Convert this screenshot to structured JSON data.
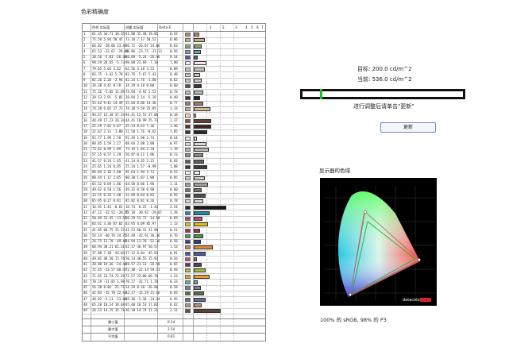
{
  "page_title": "色彩精确度",
  "table_header": {
    "idx": "",
    "ref": "色样 实际值",
    "meas": "测量 实际值",
    "delta": "Delta E",
    "scale": [
      "1",
      "2",
      "3",
      "4",
      "5",
      "6",
      "7"
    ]
  },
  "rows": [
    {
      "id": "1",
      "ref": "61.35  34.71  18.35",
      "meas": "61.80  35.48  19.81",
      "de": "0.43",
      "sw": "#c2817a",
      "v": 0.43,
      "bar": "#c2817a"
    },
    {
      "id": "2",
      "ref": "75.50  5.84  50.45",
      "meas": "73.18  7.17  50.52",
      "de": "0.86",
      "sw": "#c8b07a",
      "v": 0.86,
      "bar": "#c8b07a"
    },
    {
      "id": "3",
      "ref": "66.82  -28.06  23.47",
      "meas": "66.72  -26.07  24.06",
      "de": "0.63",
      "sw": "#8bab72",
      "v": 0.63,
      "bar": "#8bab72"
    },
    {
      "id": "4",
      "ref": "65.53  -22.67  -29.46",
      "meas": "66.86  -23.75  -31.13",
      "de": "0.56",
      "sw": "#5fa6c0",
      "v": 0.56,
      "bar": "#5fa6c0"
    },
    {
      "id": "5",
      "ref": "38.56  -5.03  -26.48",
      "meas": "40.09  -5.24  -26.96",
      "de": "0.34",
      "sw": "#505f8a",
      "v": 0.34,
      "bar": "#505f8a"
    },
    {
      "id": "6",
      "ref": "98.19  20.65  -5.73",
      "meas": "98.88  22.69  -7.16",
      "de": "1.00",
      "sw": "#f5e6ef",
      "v": 1.0,
      "bar": "#f5e6ef"
    },
    {
      "id": "7",
      "ref": "79.65  5.03  3.62",
      "meas": "82.56  4.18  3.52",
      "de": "0.89",
      "sw": "#d0c2bd",
      "v": 0.89,
      "bar": "#d0c2bd"
    },
    {
      "id": "8",
      "ref": "82.75  -1.42  5.78",
      "meas": "82.76  -5.67  5.43",
      "de": "0.48",
      "sw": "#c9ccbc",
      "v": 0.48,
      "bar": "#c9ccbc"
    },
    {
      "id": "9",
      "ref": "82.26  2.26  -2.94",
      "meas": "82.24  1.76  -1.60",
      "de": "0.62",
      "sw": "#cdc7cc",
      "v": 0.62,
      "bar": "#cdc7cc"
    },
    {
      "id": "10",
      "ref": "34.38  4.42  0.78",
      "meas": "34.29  4.10  0.80",
      "de": "0.60",
      "sw": "#5b4f50",
      "v": 0.6,
      "bar": "#3d3536"
    },
    {
      "id": "11",
      "ref": "75.16  -5.05  11.89",
      "meas": "74.94  -4.92  1.53",
      "de": "0.78",
      "sw": "#b5bdb9",
      "v": 0.78,
      "bar": "#b5bdb9"
    },
    {
      "id": "12",
      "ref": "28.13  2.91  -5.05",
      "meas": "28.94  2.14  -5.19",
      "de": "0.49",
      "sw": "#3f3e49",
      "v": 0.49,
      "bar": "#1f1e25"
    },
    {
      "id": "13",
      "ref": "55.42  9.41  14.49",
      "meas": "55.84  8.86  14.36",
      "de": "0.77",
      "sw": "#977f6c",
      "v": 0.77,
      "bar": "#977f6c"
    },
    {
      "id": "14",
      "ref": "74.20  6.05  27.73",
      "meas": "74.38  5.59  25.05",
      "de": "1.33",
      "sw": "#c5b08e",
      "v": 1.33,
      "bar": "#d4bb95"
    },
    {
      "id": "15",
      "ref": "94.57  12.38  37.24",
      "meas": "94.41  12.52  37.06",
      "de": "0.18",
      "sw": "#f7e0b4",
      "v": 0.18,
      "bar": "#f7e0b4"
    },
    {
      "id": "16",
      "ref": "44.49  17.23  26.34",
      "meas": "44.41  18.99  25.73",
      "de": "1.37",
      "sw": "#8b5a3b",
      "v": 1.37,
      "bar": "#6b3e27"
    },
    {
      "id": "17",
      "ref": "25.29  7.81  6.87",
      "meas": "25.23  8.63  7.36",
      "de": "1.36",
      "sw": "#4c3731",
      "v": 1.36,
      "bar": "#3a2722"
    },
    {
      "id": "18",
      "ref": "22.67  2.11  -1.00",
      "meas": "22.58  1.76  -0.62",
      "de": "1.05",
      "sw": "#3a3537",
      "v": 1.05,
      "bar": "#2a2526"
    },
    {
      "id": "19",
      "ref": "92.77  1.99  2.78",
      "meas": "92.49  1.98  2.74",
      "de": "0.24",
      "sw": "#ebe6e2",
      "v": 0.24,
      "bar": "#ebe6e2"
    },
    {
      "id": "20",
      "ref": "88.85  1.59  2.27",
      "meas": "88.64  2.08  2.08",
      "de": "0.97",
      "sw": "#e0dad6",
      "v": 0.97,
      "bar": "#e0dad6"
    },
    {
      "id": "21",
      "ref": "73.42  0.99  1.89",
      "meas": "73.19  1.84  2.10",
      "de": "1.19",
      "sw": "#b8b3b0",
      "v": 1.19,
      "bar": "#b8b3b0"
    },
    {
      "id": "22",
      "ref": "57.15  0.57  1.19",
      "meas": "56.97  0.11  1.96",
      "de": "0.73",
      "sw": "#8c8886",
      "v": 0.73,
      "bar": "#8c8886"
    },
    {
      "id": "23",
      "ref": "41.57  0.24  1.45",
      "meas": "41.14  0.35  2.15",
      "de": "0.83",
      "sw": "#625f5d",
      "v": 0.83,
      "bar": "#625f5d"
    },
    {
      "id": "24",
      "ref": "25.65  1.24  0.05",
      "meas": "25.34  1.57  -0.99",
      "de": "1.08",
      "sw": "#3d3a3a",
      "v": 1.08,
      "bar": "#3d3a3a"
    },
    {
      "id": "25",
      "ref": "96.04  2.16  2.60",
      "meas": "95.63  1.94  2.71",
      "de": "0.52",
      "sw": "#f6f0ec",
      "v": 0.52,
      "bar": "#f6f0ec"
    },
    {
      "id": "26",
      "ref": "80.44  1.17  2.05",
      "meas": "80.38  1.87  1.80",
      "de": "0.85",
      "sw": "#cac5c1",
      "v": 0.85,
      "bar": "#cac5c1"
    },
    {
      "id": "27",
      "ref": "65.52  0.69  1.86",
      "meas": "64.50  0.86  1.96",
      "de": "1.11",
      "sw": "#a19d9a",
      "v": 1.11,
      "bar": "#a19d9a"
    },
    {
      "id": "28",
      "ref": "49.62  0.58  1.56",
      "meas": "49.32  0.50  0.90",
      "de": "0.60",
      "sw": "#787572",
      "v": 0.6,
      "bar": "#787572"
    },
    {
      "id": "29",
      "ref": "33.55  0.35  1.40",
      "meas": "32.69  0.64  0.82",
      "de": "0.92",
      "sw": "#4f4d4b",
      "v": 0.92,
      "bar": "#4f4d4b"
    },
    {
      "id": "30",
      "ref": "85.95  0.27  0.81",
      "meas": "85.82  0.81  0.26",
      "de": "0.78",
      "sw": "#d9d5d3",
      "v": 0.78,
      "bar": "#d9d5d3"
    },
    {
      "id": "31",
      "ref": "16.91  1.43  -0.81",
      "meas": "18.74  -0.25  -1.42",
      "de": "2.54",
      "sw": "#2b2a2c",
      "v": 2.54,
      "bar": "#1a1a1c"
    },
    {
      "id": "32",
      "ref": "47.12  -32.52  -28.75",
      "meas": "47.18  -30.92  -29.07",
      "de": "1.28",
      "sw": "#2f8aa1",
      "v": 1.28,
      "bar": "#1f8aa8"
    },
    {
      "id": "33",
      "ref": "50.49  53.45  -13.55",
      "meas": "50.29  53.73  -14.58",
      "de": "0.69",
      "sw": "#b5467d",
      "v": 0.69,
      "bar": "#b5467d"
    },
    {
      "id": "34",
      "ref": "83.61  3.36  87.02",
      "meas": "83.95  4.09  85.97",
      "de": "1.13",
      "sw": "#e1c20b",
      "v": 1.13,
      "bar": "#e1c20b"
    },
    {
      "id": "35",
      "ref": "41.05  60.75  31.17",
      "meas": "41.53  60.31  31.96",
      "de": "0.51",
      "sw": "#b4303a",
      "v": 0.51,
      "bar": "#b4303a"
    },
    {
      "id": "36",
      "ref": "54.14  -40.76  34.75",
      "meas": "54.49  -42.91  36.36",
      "de": "0.76",
      "sw": "#47954a",
      "v": 0.76,
      "bar": "#47954a"
    },
    {
      "id": "37",
      "ref": "24.75  13.78  -49.48",
      "meas": "24.94  13.78  -52.36",
      "de": "0.58",
      "sw": "#2c3d8e",
      "v": 0.58,
      "bar": "#2c3d8e"
    },
    {
      "id": "38",
      "ref": "60.94  38.21  61.31",
      "meas": "62.17  36.97  56.57",
      "de": "1.53",
      "sw": "#d88337",
      "v": 1.53,
      "bar": "#e08a30"
    },
    {
      "id": "39",
      "ref": "37.80  7.30  -43.04",
      "meas": "37.12  8.04  -45.93",
      "de": "0.91",
      "sw": "#4e57a3",
      "v": 0.91,
      "bar": "#4e57a3"
    },
    {
      "id": "40",
      "ref": "49.81  48.50  15.76",
      "meas": "50.14  48.55  15.93",
      "de": "0.26",
      "sw": "#ba5d74",
      "v": 0.26,
      "bar": "#ba5d74"
    },
    {
      "id": "41",
      "ref": "28.88  19.36  -24.48",
      "meas": "28.57  21.13  -26.58",
      "de": "0.65",
      "sw": "#553c66",
      "v": 0.65,
      "bar": "#553c66"
    },
    {
      "id": "42",
      "ref": "72.45  -23.57  60.47",
      "meas": "72.30  -22.14  59.73",
      "de": "0.93",
      "sw": "#9fbc40",
      "v": 0.93,
      "bar": "#9fbc40"
    },
    {
      "id": "43",
      "ref": "71.65  23.74  72.28",
      "meas": "72.57  23.80  66.76",
      "de": "1.23",
      "sw": "#e6a22b",
      "v": 1.23,
      "bar": "#e6a22b"
    },
    {
      "id": "44",
      "ref": "70.19  -31.85  1.98",
      "meas": "70.17  -32.71  1.70",
      "de": "0.33",
      "sw": "#5cb8a8",
      "v": 0.33,
      "bar": "#5cb8a8"
    },
    {
      "id": "45",
      "ref": "54.38  8.84  -25.71",
      "meas": "54.29  8.10  -26.98",
      "de": "0.58",
      "sw": "#7a80b2",
      "v": 0.58,
      "bar": "#7a80b2"
    },
    {
      "id": "46",
      "ref": "42.03  -15.78  22.93",
      "meas": "42.17  -15.19  21.16",
      "de": "0.83",
      "sw": "#5c7046",
      "v": 0.83,
      "bar": "#5c7046"
    },
    {
      "id": "47",
      "ref": "48.82  -5.11  -23.08",
      "meas": "49.36  -5.36  -24.34",
      "de": "0.95",
      "sw": "#5f7196",
      "v": 0.95,
      "bar": "#5f7196"
    },
    {
      "id": "48",
      "ref": "65.10  18.14  18.68",
      "meas": "65.40  18.53  17.82",
      "de": "0.62",
      "sw": "#c08e7e",
      "v": 0.62,
      "bar": "#c08e7e"
    },
    {
      "id": "49",
      "ref": "36.13  14.15  15.78",
      "meas": "36.10  14.74  11.21",
      "de": "2.11",
      "sw": "#6b4c3c",
      "v": 2.11,
      "bar": "#5e4034"
    }
  ],
  "summary": [
    {
      "label": "最小值",
      "value": "0.14"
    },
    {
      "label": "最大值",
      "value": "2.54"
    },
    {
      "label": "平均值",
      "value": "0.81"
    }
  ],
  "target_label": "目标: 200.0 cd/m^2",
  "current_label": "当前: 536.0 cd/m^2",
  "level_marker": 0.12,
  "prompt_text": "进行调整后请单击\"更新\"",
  "update_button": "更新",
  "gamut_title": "显示器的色域",
  "gamut_caption": "100% 的 sRGB, 98% 的 P3",
  "brand_text": "datacolor",
  "colors": {
    "marker": "#1bbf2a",
    "button_border": "#6a8ccc"
  }
}
